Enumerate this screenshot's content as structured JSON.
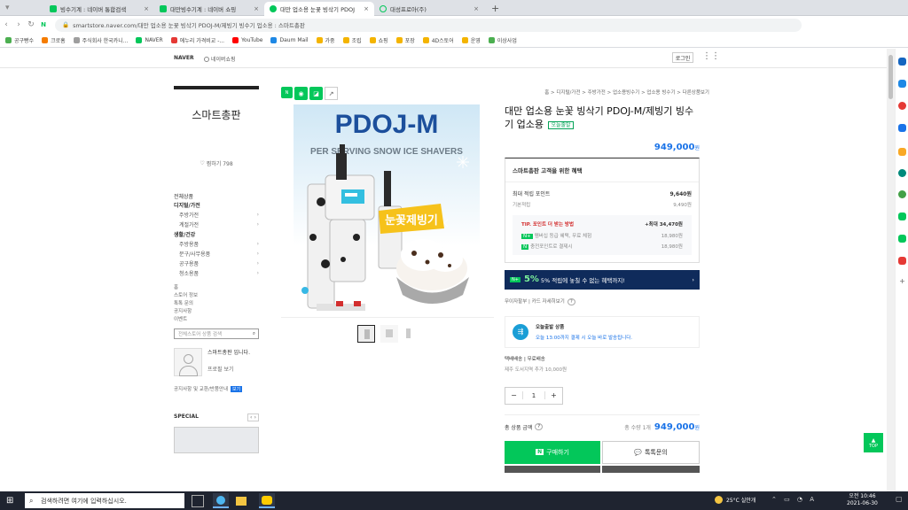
{
  "browser": {
    "tabs": [
      {
        "label": "빙수기계 : 네이버 통합검색",
        "color": "#03c75a"
      },
      {
        "label": "대만빙수기계 : 네이버 쇼핑",
        "color": "#03c75a"
      },
      {
        "label": "대만 업소용 눈꽃 빙삭기 PDOJ",
        "color": "#03c75a"
      },
      {
        "label": "대성프로아(주)",
        "color": "#1a73e8"
      }
    ],
    "url": "smartstore.naver.com/대만 업소용 눈꽃 빙삭기 PDOJ-M/제빙기 빙수기 업소용 : 스마트총판",
    "bookmarks": [
      {
        "label": "공구빵수",
        "color": "#4caf50"
      },
      {
        "label": "크로홈",
        "color": "#f57c00"
      },
      {
        "label": "주식회사 한국카니...",
        "color": "#9e9e9e"
      },
      {
        "label": "NAVER",
        "color": "#03c75a"
      },
      {
        "label": "에누리 가격비교 -...",
        "color": "#e53935"
      },
      {
        "label": "YouTube",
        "color": "#ff0000"
      },
      {
        "label": "Daum Mail",
        "color": "#1e88e5"
      },
      {
        "label": "가중",
        "color": "#f4b400"
      },
      {
        "label": "조립",
        "color": "#f4b400"
      },
      {
        "label": "쇼핑",
        "color": "#f4b400"
      },
      {
        "label": "포장",
        "color": "#f4b400"
      },
      {
        "label": "4D스토어",
        "color": "#f4b400"
      },
      {
        "label": "운영",
        "color": "#f4b400"
      },
      {
        "label": "이상사업",
        "color": "#4caf50"
      }
    ]
  },
  "gnb": {
    "logo": "NAVER",
    "store_link": "네이버쇼핑",
    "login": "로그인"
  },
  "store": {
    "name": "스마트총판",
    "zzim": "찜하기 798",
    "all_products": "전체상품",
    "cats": [
      {
        "label": "디지털/가전",
        "bold": true
      },
      {
        "label": "주방가전",
        "sub": true
      },
      {
        "label": "계절가전",
        "sub": true
      },
      {
        "label": "생활/건강",
        "bold": true
      },
      {
        "label": "주방용품",
        "sub": true
      },
      {
        "label": "문구/사무용품",
        "sub": true
      },
      {
        "label": "공구용품",
        "sub": true
      },
      {
        "label": "청소용품",
        "sub": true
      }
    ],
    "links": [
      "홈",
      "스토어 정보",
      "톡톡 문의",
      "공지사항",
      "이벤트"
    ],
    "search_placeholder": "전체스토어 상품 검색",
    "seller": "스마트총판 입니다.",
    "more": "프로필 보기",
    "notice": "공지사항 및 교환/반품안내",
    "special": "SPECIAL"
  },
  "breadcrumb": "홈 > 디지털/가전 > 주방가전 > 업소용빙수기 > 업소용 빙수기 > 다른상품보기",
  "product": {
    "img_title": "PDOJ-M",
    "img_sub": "PER SERVING SNOW ICE SHAVERS",
    "img_badge": "눈꽃제빙기",
    "title": "대만 업소용 눈꽃 빙삭기 PDOJ-M/제빙기 빙수기 업소용",
    "tag": "오늘출발",
    "price": "949,000",
    "won": "원",
    "benefit_title": "스마트총판 고객을 위한 혜택",
    "point_label": "최대 적립 포인트",
    "point_val": "9,640원",
    "basic_label": "기본적립",
    "basic_val": "9,490원",
    "tip_title": "TIP. 포인트 더 받는 방법",
    "tip_val": "+최대 34,470원",
    "tip1": "멤버십 등급 혜택, 무료 체험",
    "tip1_val": "18,980원",
    "tip2": "충전포인트로 결제시",
    "tip2_val": "18,980원",
    "banner": "5% 적립에 놓칠 수 없는 혜택까지!",
    "banner_pct": "5%",
    "card_link": "무이자할부 | 카드 자세히보기",
    "delivery_title": "오늘출발 상품",
    "delivery_desc": "오늘 13:00까지 결제 시 오늘 바로 발송됩니다.",
    "ship_label": "택배배송 | 무료배송",
    "ship_note": "제주 도서지역 추가 10,000원",
    "qty": "1",
    "total_label": "총 상품 금액",
    "total_qty": "총 수량 1개",
    "total_price": "949,000",
    "buy": "구매하기",
    "talk": "톡톡문의"
  },
  "taskbar": {
    "search": "검색하려면 여기에 입력하십시오.",
    "weather": "25°C 실안개",
    "time": "오전 10:46",
    "date": "2021-06-30"
  },
  "top_button": "TOP"
}
